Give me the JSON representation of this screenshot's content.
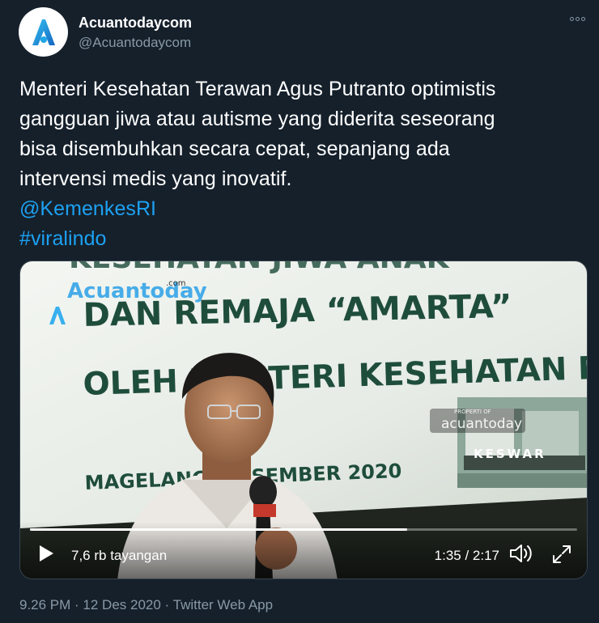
{
  "account": {
    "display_name": "Acuantodaycom",
    "handle": "@Acuantodaycom"
  },
  "tweet": {
    "lines": [
      "Menteri Kesehatan Terawan Agus Putranto optimistis",
      "gangguan jiwa atau autisme yang diderita seseorang",
      "bisa disembuhkan secara cepat, sepanjang ada",
      "intervensi medis yang inovatif."
    ],
    "mention": "@KemenkesRI",
    "hashtag": "#viralindo"
  },
  "video": {
    "banner_line1": "DAN REMAJA “AMARTA”",
    "banner_line2": "OLEH MENTERI KESEHATAN RI",
    "banner_line3": "MAGELANG, DESEMBER 2020",
    "watermark_left": "Acuantoday",
    "watermark_com": ".com",
    "watermark_right": "acuantoday",
    "watermark_properti": "PROPERTI OF",
    "photo_label": "KESWAR",
    "views": "7,6 rb tayangan",
    "time": "1:35 / 2:17",
    "progress": 0.69
  },
  "footer": {
    "meta": "9.26 PM · 12 Des 2020 · Twitter Web App"
  },
  "colors": {
    "background": "#15202b",
    "link": "#1da1f2",
    "muted": "#8899a6"
  },
  "icons": [
    "logo-icon",
    "more-icon",
    "play-icon",
    "volume-icon",
    "fullscreen-icon"
  ]
}
